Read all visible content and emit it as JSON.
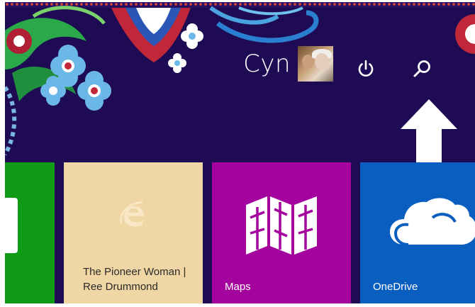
{
  "header": {
    "username": "Cyn"
  },
  "icons": {
    "avatar": "user-avatar-photo",
    "power": "power-icon",
    "search": "search-icon",
    "arrow": "arrow-up-icon"
  },
  "tiles": [
    {
      "id": "partial-green",
      "label": ""
    },
    {
      "id": "pioneer-woman",
      "label_line1": "The Pioneer Woman |",
      "label_line2": "Ree Drummond",
      "icon": "internet-explorer-icon"
    },
    {
      "id": "maps",
      "label": "Maps",
      "icon": "maps-icon"
    },
    {
      "id": "onedrive",
      "label": "OneDrive",
      "icon": "cloud-icon"
    }
  ],
  "colors": {
    "background": "#1e0b54",
    "green_tile": "#109b17",
    "pioneer_tile": "#f0d6a5",
    "maps_tile": "#a4039e",
    "onedrive_tile": "#0a5ec0",
    "arrow": "#ffffff"
  }
}
